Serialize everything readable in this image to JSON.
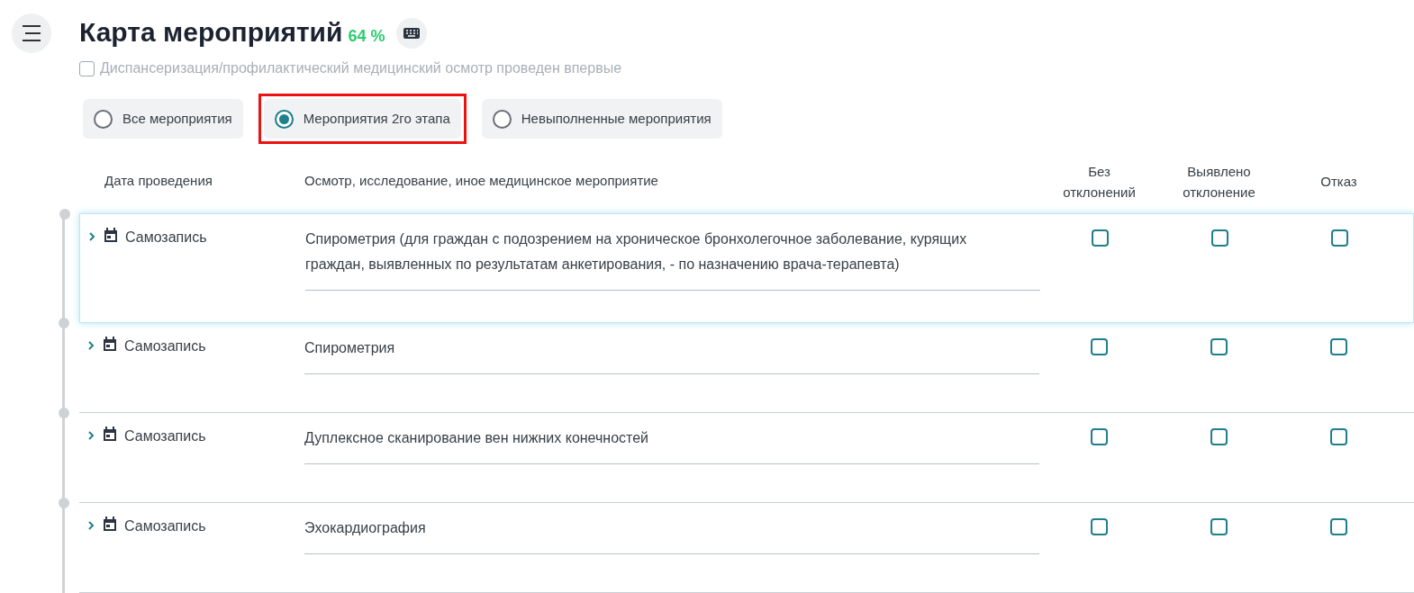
{
  "title": "Карта мероприятий",
  "progress": "64 %",
  "first_time": {
    "label": "Диспансеризация/профилактический медицинский осмотр проведен впервые",
    "checked": false
  },
  "filters": [
    {
      "label": "Все мероприятия",
      "selected": false,
      "highlighted": false
    },
    {
      "label": "Мероприятия 2го этапа",
      "selected": true,
      "highlighted": true
    },
    {
      "label": "Невыполненные мероприятия",
      "selected": false,
      "highlighted": false
    }
  ],
  "columns": [
    "Дата проведения",
    "Осмотр, исследование, иное медицинское мероприятие",
    "Без отклонений",
    "Выявлено отклонение",
    "Отказ"
  ],
  "rows": [
    {
      "date": "Самозапись",
      "event": "Спирометрия (для граждан с подозрением на хроническое бронхолегочное заболевание, курящих граждан, выявленных по результатам анкетирования, - по назначению врача-терапевта)",
      "active": true,
      "no_deviation": false,
      "deviation": false,
      "refusal": false
    },
    {
      "date": "Самозапись",
      "event": "Спирометрия",
      "active": false,
      "no_deviation": false,
      "deviation": false,
      "refusal": false
    },
    {
      "date": "Самозапись",
      "event": "Дуплексное сканирование вен нижних конечностей",
      "active": false,
      "no_deviation": false,
      "deviation": false,
      "refusal": false
    },
    {
      "date": "Самозапись",
      "event": "Эхокардиография",
      "active": false,
      "no_deviation": false,
      "deviation": false,
      "refusal": false
    }
  ]
}
